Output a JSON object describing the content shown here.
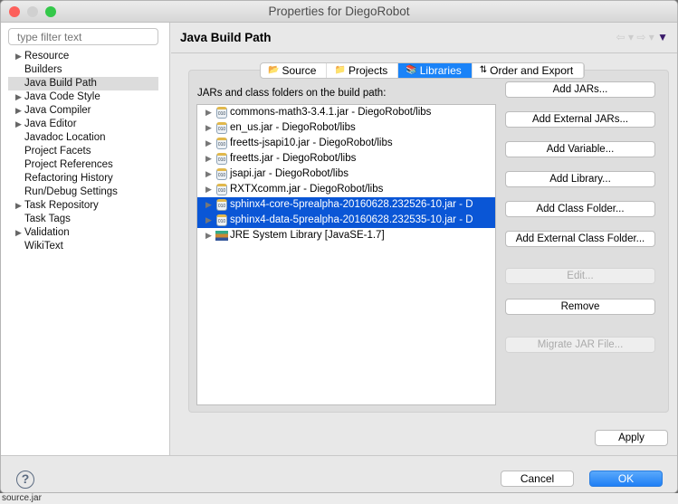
{
  "window": {
    "title": "Properties for DiegoRobot"
  },
  "filter": {
    "placeholder": "type filter text"
  },
  "tree": [
    {
      "label": "Resource",
      "expandable": true
    },
    {
      "label": "Builders",
      "expandable": false
    },
    {
      "label": "Java Build Path",
      "expandable": false,
      "selected": true
    },
    {
      "label": "Java Code Style",
      "expandable": true
    },
    {
      "label": "Java Compiler",
      "expandable": true
    },
    {
      "label": "Java Editor",
      "expandable": true
    },
    {
      "label": "Javadoc Location",
      "expandable": false
    },
    {
      "label": "Project Facets",
      "expandable": false
    },
    {
      "label": "Project References",
      "expandable": false
    },
    {
      "label": "Refactoring History",
      "expandable": false
    },
    {
      "label": "Run/Debug Settings",
      "expandable": false
    },
    {
      "label": "Task Repository",
      "expandable": true
    },
    {
      "label": "Task Tags",
      "expandable": false
    },
    {
      "label": "Validation",
      "expandable": true
    },
    {
      "label": "WikiText",
      "expandable": false
    }
  ],
  "header": {
    "title": "Java Build Path",
    "back": "⇦",
    "forward": "⇨",
    "menu": "▼"
  },
  "tabs": [
    {
      "label": "Source",
      "icon": "source-folder-icon"
    },
    {
      "label": "Projects",
      "icon": "folder-icon"
    },
    {
      "label": "Libraries",
      "icon": "books-icon",
      "active": true
    },
    {
      "label": "Order and Export",
      "icon": "order-arrows-icon"
    }
  ],
  "list_label": "JARs and class folders on the build path:",
  "entries": [
    {
      "label": "commons-math3-3.4.1.jar - DiegoRobot/libs",
      "icon": "jar-icon"
    },
    {
      "label": "en_us.jar - DiegoRobot/libs",
      "icon": "jar-icon"
    },
    {
      "label": "freetts-jsapi10.jar - DiegoRobot/libs",
      "icon": "jar-icon"
    },
    {
      "label": "freetts.jar - DiegoRobot/libs",
      "icon": "jar-icon"
    },
    {
      "label": "jsapi.jar - DiegoRobot/libs",
      "icon": "jar-icon"
    },
    {
      "label": "RXTXcomm.jar - DiegoRobot/libs",
      "icon": "jar-icon"
    },
    {
      "label": "sphinx4-core-5prealpha-20160628.232526-10.jar - D",
      "icon": "jar-icon",
      "selected": true
    },
    {
      "label": "sphinx4-data-5prealpha-20160628.232535-10.jar - D",
      "icon": "jar-icon",
      "selected": true
    },
    {
      "label": "JRE System Library [JavaSE-1.7]",
      "icon": "library-icon"
    }
  ],
  "buttons": [
    {
      "label": "Add JARs...",
      "enabled": true
    },
    {
      "label": "Add External JARs...",
      "enabled": true
    },
    {
      "label": "Add Variable...",
      "enabled": true
    },
    {
      "label": "Add Library...",
      "enabled": true
    },
    {
      "label": "Add Class Folder...",
      "enabled": true
    },
    {
      "label": "Add External Class Folder...",
      "enabled": true
    },
    {
      "label": "Edit...",
      "enabled": false
    },
    {
      "label": "Remove",
      "enabled": true
    },
    {
      "label": "Migrate JAR File...",
      "enabled": false
    }
  ],
  "apply": "Apply",
  "footer": {
    "help": "?",
    "cancel": "Cancel",
    "ok": "OK"
  },
  "background_text": "source.jar",
  "colors": {
    "accent": "#1a83f8",
    "selection": "#0a56d6"
  }
}
